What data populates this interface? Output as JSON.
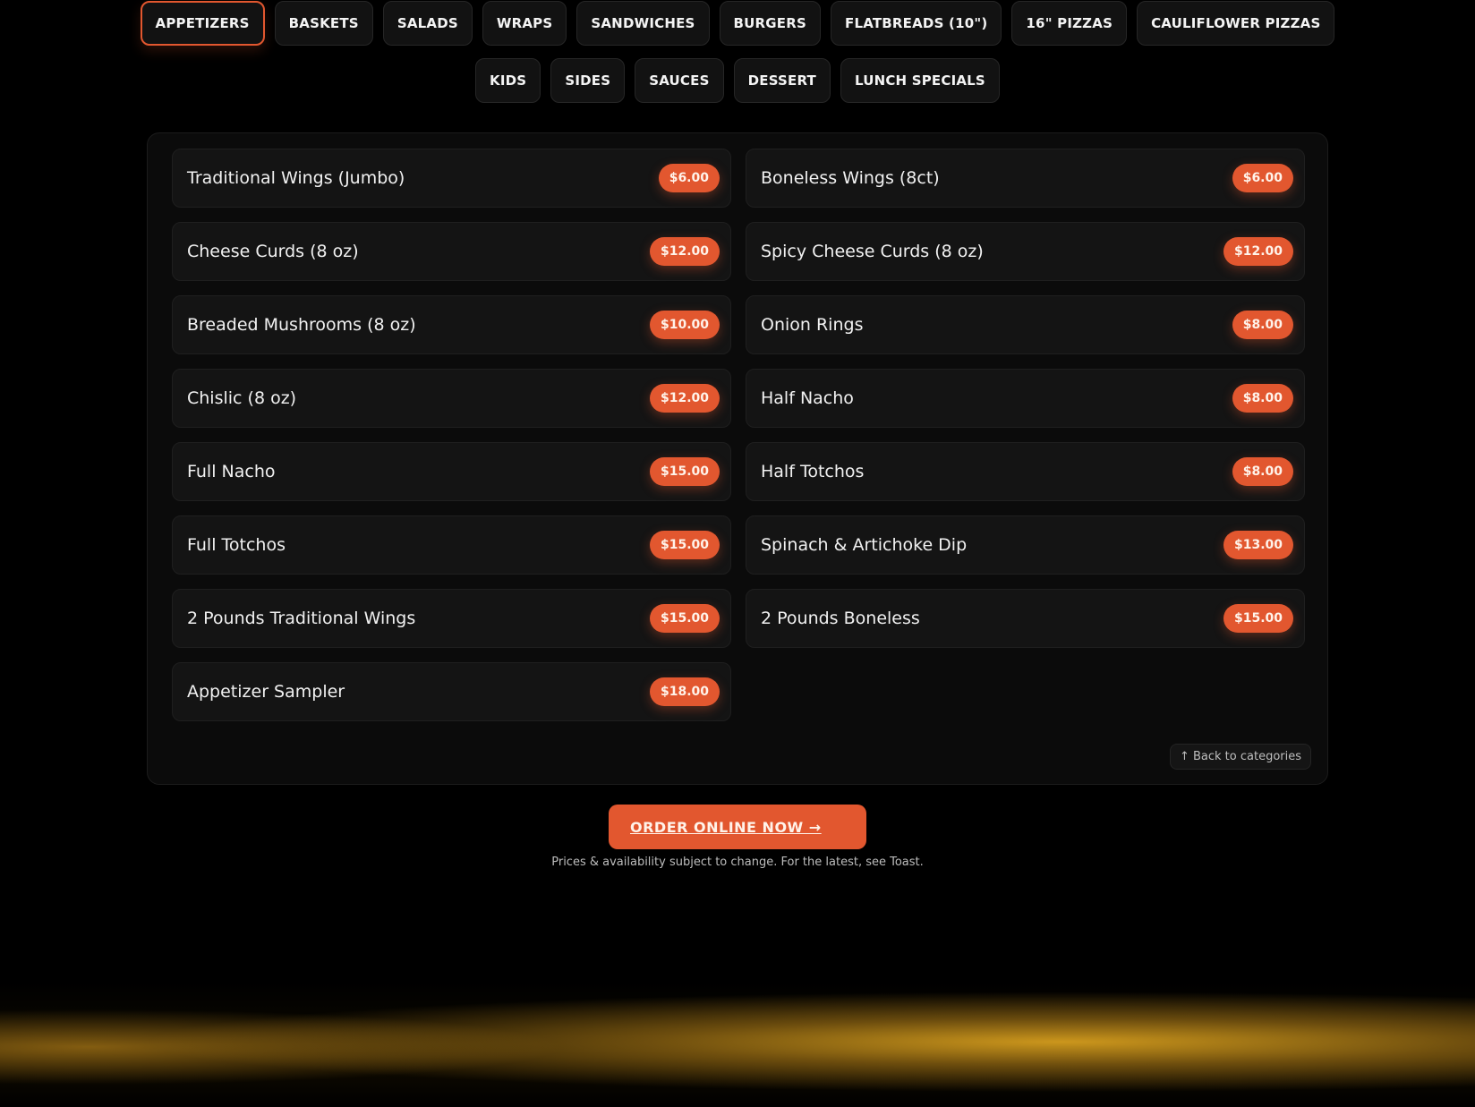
{
  "categories_row1": [
    "APPETIZERS",
    "BASKETS",
    "SALADS",
    "WRAPS",
    "SANDWICHES",
    "BURGERS",
    "FLATBREADS (10\")",
    "16\" PIZZAS",
    "CAULIFLOWER PIZZAS"
  ],
  "categories_row2": [
    "KIDS",
    "SIDES",
    "SAUCES",
    "DESSERT",
    "LUNCH SPECIALS"
  ],
  "active_category": "APPETIZERS",
  "items": [
    {
      "name": "Traditional Wings (Jumbo)",
      "price": "$6.00"
    },
    {
      "name": "Boneless Wings (8ct)",
      "price": "$6.00"
    },
    {
      "name": "Cheese Curds (8 oz)",
      "price": "$12.00"
    },
    {
      "name": "Spicy Cheese Curds (8 oz)",
      "price": "$12.00"
    },
    {
      "name": "Breaded Mushrooms (8 oz)",
      "price": "$10.00"
    },
    {
      "name": "Onion Rings",
      "price": "$8.00"
    },
    {
      "name": "Chislic (8 oz)",
      "price": "$12.00"
    },
    {
      "name": "Half Nacho",
      "price": "$8.00"
    },
    {
      "name": "Full Nacho",
      "price": "$15.00"
    },
    {
      "name": "Half Totchos",
      "price": "$8.00"
    },
    {
      "name": "Full Totchos",
      "price": "$15.00"
    },
    {
      "name": "Spinach & Artichoke Dip",
      "price": "$13.00"
    },
    {
      "name": "2 Pounds Traditional Wings",
      "price": "$15.00"
    },
    {
      "name": "2 Pounds Boneless",
      "price": "$15.00"
    },
    {
      "name": "Appetizer Sampler",
      "price": "$18.00"
    }
  ],
  "back_label": "↑ Back to categories",
  "order_label": "ORDER ONLINE NOW →",
  "disclaimer": "Prices & availability subject to change. For the latest, see Toast.",
  "colors": {
    "accent": "#e2572f",
    "background": "#000000",
    "card": "#141414",
    "glow": "#d69e1e"
  }
}
